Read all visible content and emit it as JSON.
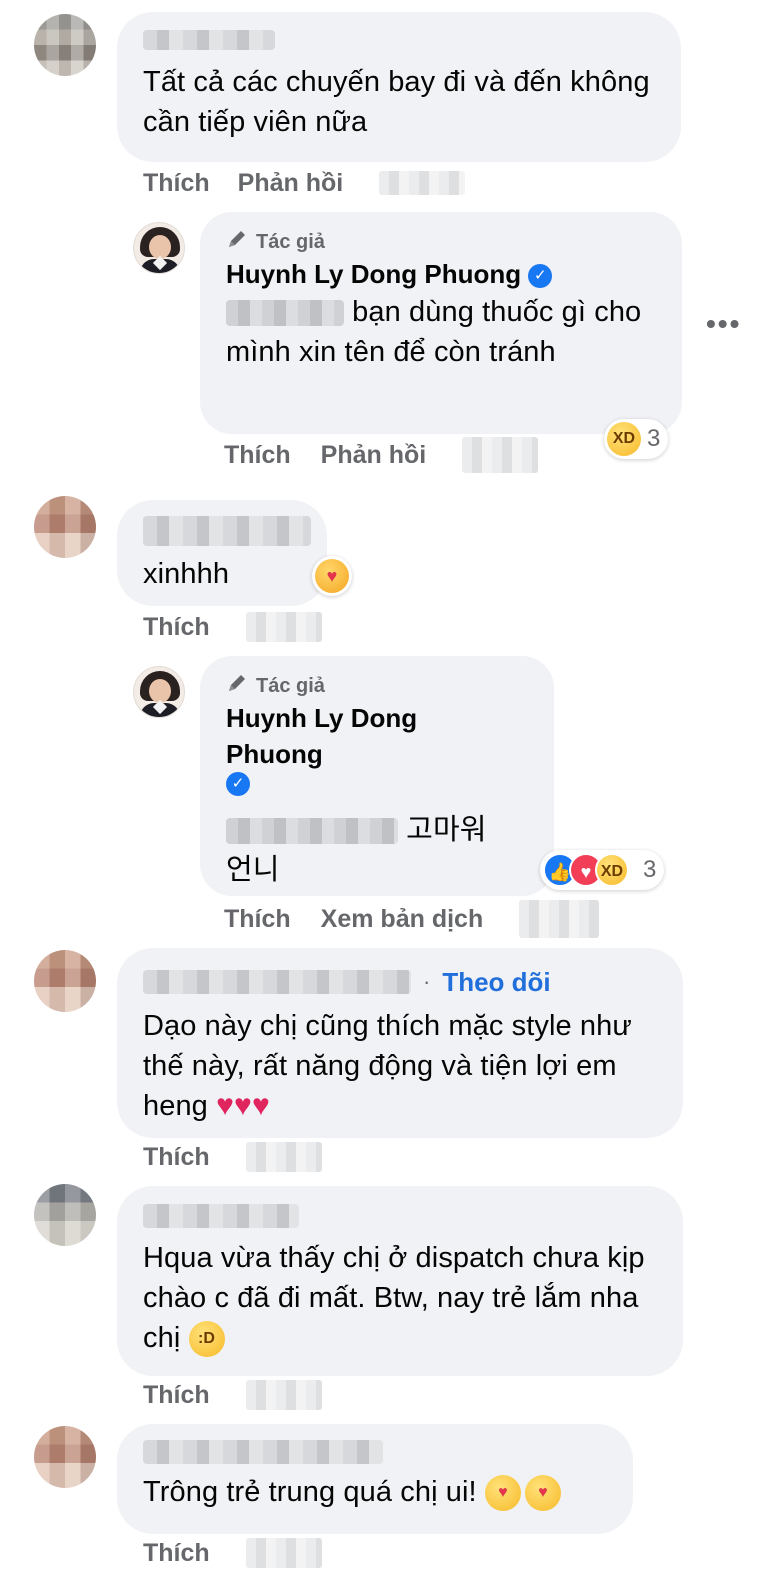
{
  "labels": {
    "like": "Thích",
    "reply": "Phản hồi",
    "see_translation": "Xem bản dịch",
    "author_tag": "Tác giả",
    "follow": "Theo dõi",
    "more": "•••"
  },
  "comments": [
    {
      "text": "Tất cả các chuyến bay đi và đến không cần tiếp viên nữa"
    },
    {
      "author": "Huynh Ly Dong Phuong",
      "text": "bạn dùng thuốc gì cho mình xin tên để còn tránh",
      "reaction_count": "3"
    },
    {
      "text": "xinhhh"
    },
    {
      "author_line1": "Huynh Ly Dong",
      "author_line2": "Phuong",
      "text_line1": "고마워",
      "text_line2": "언니",
      "reaction_count": "3"
    },
    {
      "text": "Dạo này chị cũng thích mặc style như thế này, rất năng động và tiện lợi em heng"
    },
    {
      "text": "Hqua vừa thấy chị ở dispatch chưa kịp chào c đã đi mất. Btw, nay trẻ lắm nha chị"
    },
    {
      "text": "Trông trẻ trung quá chị ui!"
    }
  ]
}
